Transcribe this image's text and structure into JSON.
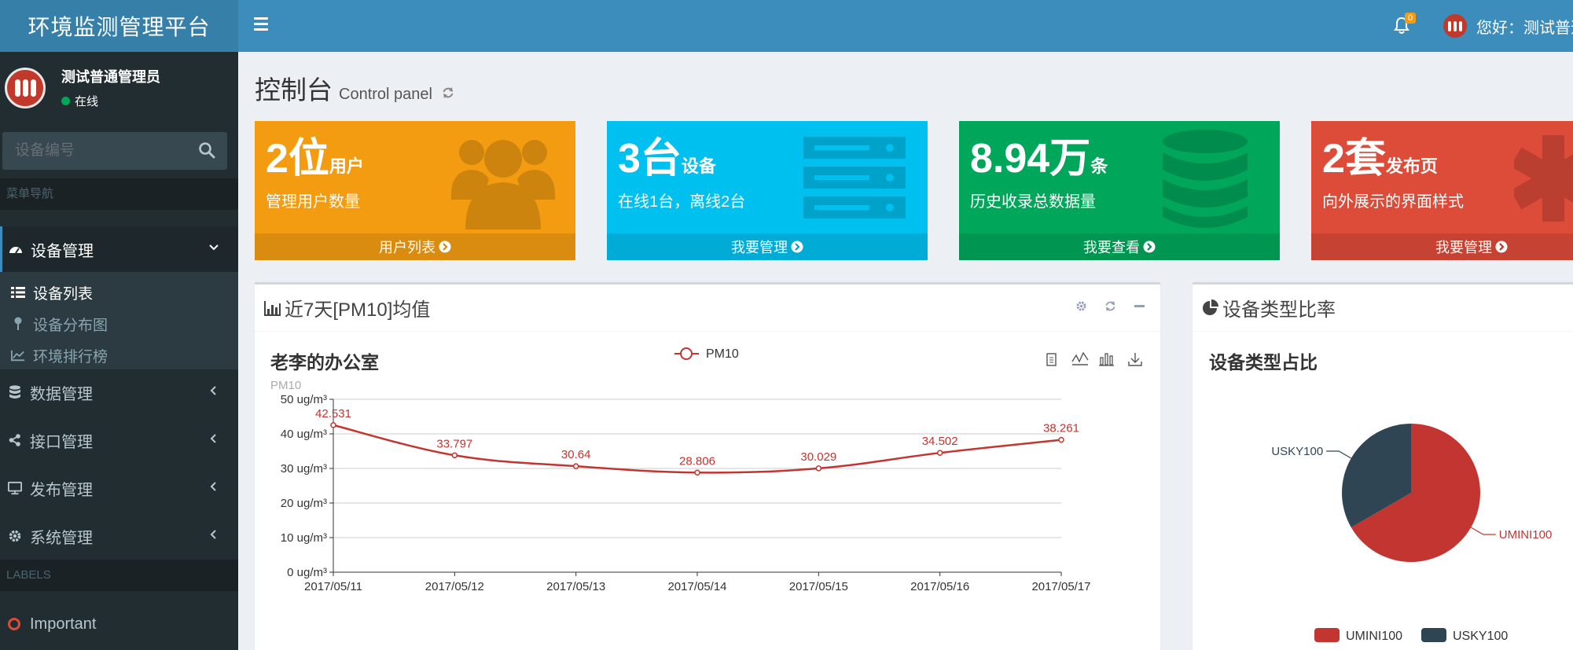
{
  "app": {
    "title": "环境监测管理平台"
  },
  "topbar": {
    "notification_count": "0",
    "greeting": "您好：测试普通管理员"
  },
  "sidebar": {
    "user_name": "测试普通管理员",
    "user_status": "在线",
    "search_placeholder": "设备编号",
    "nav_header": "菜单导航",
    "menu": [
      {
        "label": "设备管理",
        "icon": "dashboard-icon"
      },
      {
        "label": "数据管理",
        "icon": "database-icon"
      },
      {
        "label": "接口管理",
        "icon": "share-icon"
      },
      {
        "label": "发布管理",
        "icon": "desktop-icon"
      },
      {
        "label": "系统管理",
        "icon": "gear-icon"
      }
    ],
    "submenu": [
      {
        "label": "设备列表",
        "icon": "list-icon"
      },
      {
        "label": "设备分布图",
        "icon": "map-pin-icon"
      },
      {
        "label": "环境排行榜",
        "icon": "line-chart-icon"
      }
    ],
    "labels_header": "LABELS",
    "labels": [
      {
        "label": "Important",
        "color": "#dd4b39"
      }
    ]
  },
  "page": {
    "title": "控制台",
    "subtitle": "Control panel"
  },
  "boxes": [
    {
      "number": "2位",
      "unit": "用户",
      "desc": "管理用户数量",
      "link": "用户列表",
      "color": "#f39c12",
      "icon": "users-icon"
    },
    {
      "number": "3台",
      "unit": "设备",
      "desc": "在线1台，离线2台",
      "link": "我要管理",
      "color": "#00c0ef",
      "icon": "server-icon"
    },
    {
      "number": "8.94万",
      "unit": "条",
      "desc": "历史收录总数据量",
      "link": "我要查看",
      "color": "#00a65a",
      "icon": "database-icon"
    },
    {
      "number": "2套",
      "unit": "发布页",
      "desc": "向外展示的界面样式",
      "link": "我要管理",
      "color": "#dd4b39",
      "icon": "asterisk-icon"
    }
  ],
  "line_panel": {
    "title": "近7天[PM10]均值"
  },
  "pie_panel": {
    "title": "设备类型比率"
  },
  "chart_data": [
    {
      "type": "line",
      "title": "老李的办公室",
      "ylabel": "PM10",
      "legend": [
        "PM10"
      ],
      "legend_position": "top-center",
      "categories": [
        "2017/05/11",
        "2017/05/12",
        "2017/05/13",
        "2017/05/14",
        "2017/05/15",
        "2017/05/16",
        "2017/05/17"
      ],
      "series": [
        {
          "name": "PM10",
          "values": [
            42.531,
            33.797,
            30.64,
            28.806,
            30.029,
            34.502,
            38.261
          ],
          "color": "#c23531"
        }
      ],
      "y_ticks": [
        "0 ug/m³",
        "10 ug/m³",
        "20 ug/m³",
        "30 ug/m³",
        "40 ug/m³",
        "50 ug/m³"
      ],
      "ylim": [
        0,
        50
      ],
      "grid": true
    },
    {
      "type": "pie",
      "title": "设备类型占比",
      "legend_position": "bottom-center",
      "slices": [
        {
          "name": "UMINI100",
          "value": 2,
          "color": "#c23531"
        },
        {
          "name": "USKY100",
          "value": 1,
          "color": "#2f4554"
        }
      ]
    }
  ]
}
